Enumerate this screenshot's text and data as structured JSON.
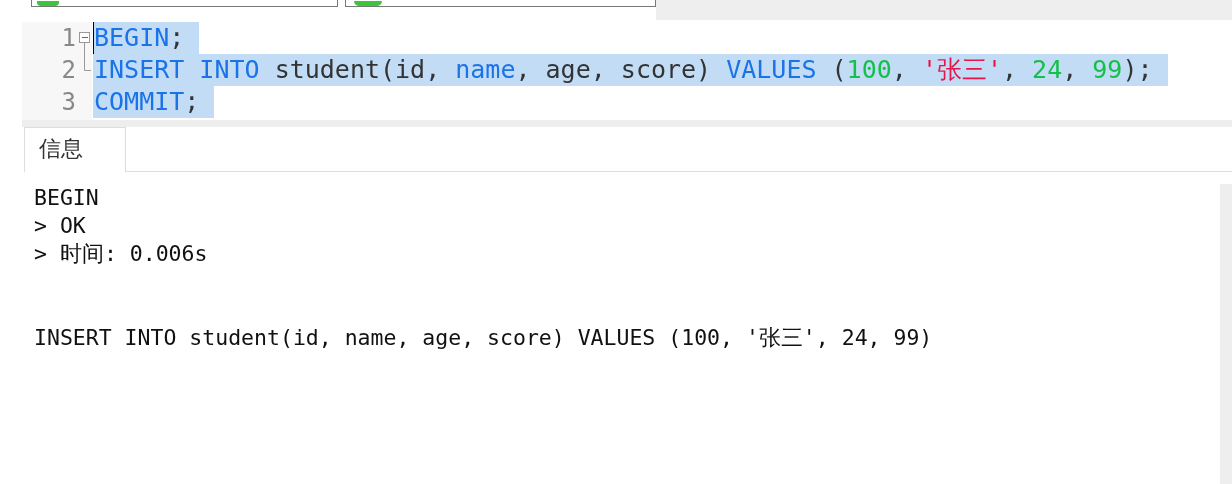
{
  "editor": {
    "lines": [
      {
        "number": "1",
        "kind": "fold-start",
        "selected": true,
        "tokens": [
          {
            "text": "BEGIN",
            "kind": "keyword"
          },
          {
            "text": ";",
            "kind": "plain"
          }
        ]
      },
      {
        "number": "2",
        "kind": "fold-end",
        "selected": true,
        "tokens": [
          {
            "text": "INSERT INTO",
            "kind": "keyword"
          },
          {
            "text": " student(id, ",
            "kind": "plain"
          },
          {
            "text": "name",
            "kind": "keyword"
          },
          {
            "text": ", age, score) ",
            "kind": "plain"
          },
          {
            "text": "VALUES",
            "kind": "keyword"
          },
          {
            "text": " (",
            "kind": "plain"
          },
          {
            "text": "100",
            "kind": "number"
          },
          {
            "text": ", ",
            "kind": "plain"
          },
          {
            "text": "'张三'",
            "kind": "string"
          },
          {
            "text": ", ",
            "kind": "plain"
          },
          {
            "text": "24",
            "kind": "number"
          },
          {
            "text": ", ",
            "kind": "plain"
          },
          {
            "text": "99",
            "kind": "number"
          },
          {
            "text": ");",
            "kind": "plain"
          }
        ]
      },
      {
        "number": "3",
        "kind": "plain",
        "selected": true,
        "tokens": [
          {
            "text": "COMMIT",
            "kind": "keyword"
          },
          {
            "text": ";",
            "kind": "plain"
          }
        ]
      }
    ]
  },
  "tabs": [
    {
      "label": "信息",
      "selected": true
    }
  ],
  "messages": [
    {
      "lines": [
        "BEGIN",
        "> OK",
        "> 时间: 0.006s"
      ]
    },
    {
      "lines": [
        "INSERT INTO student(id, name, age, score) VALUES (100, '张三', 24, 99)"
      ]
    }
  ]
}
